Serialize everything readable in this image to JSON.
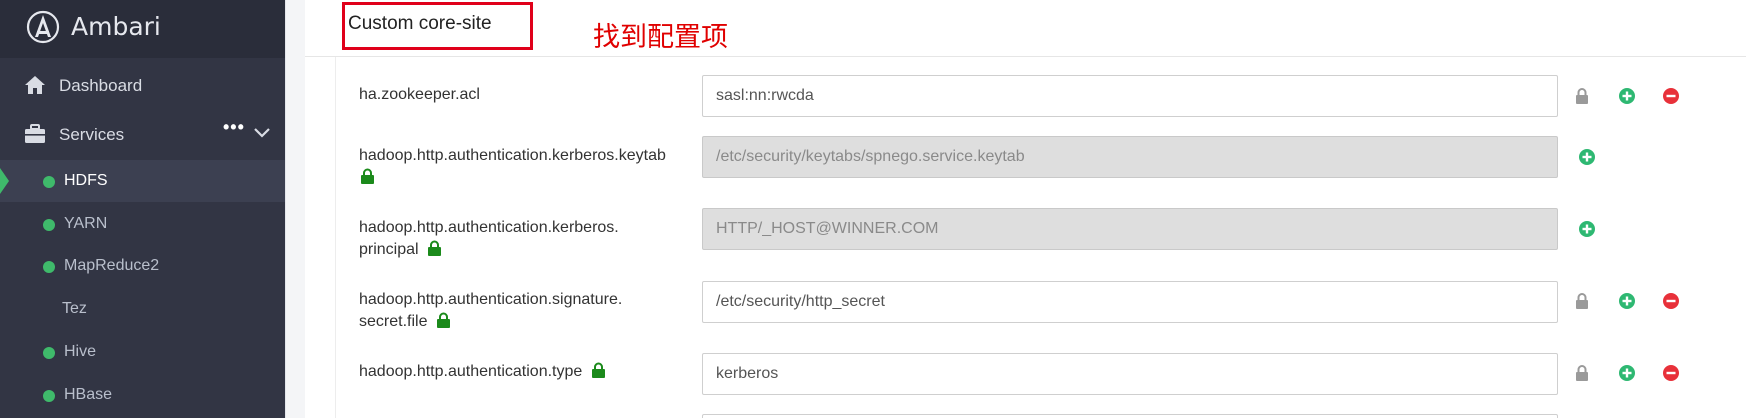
{
  "app": {
    "name": "Ambari"
  },
  "sidebar": {
    "dashboard_label": "Dashboard",
    "services_label": "Services",
    "services_more": "•••",
    "services": [
      {
        "label": "HDFS",
        "status": "green",
        "active": true
      },
      {
        "label": "YARN",
        "status": "green"
      },
      {
        "label": "MapReduce2",
        "status": "green"
      },
      {
        "label": "Tez",
        "status": "none"
      },
      {
        "label": "Hive",
        "status": "green"
      },
      {
        "label": "HBase",
        "status": "green"
      }
    ]
  },
  "section": {
    "title": "Custom core-site",
    "annotation": "找到配置项"
  },
  "properties": [
    {
      "label": "ha.zookeeper.acl",
      "value": "sasl:nn:rwcda",
      "disabled": false,
      "secured": false
    },
    {
      "label": "hadoop.http.authentication.kerberos.keytab",
      "value": "/etc/security/keytabs/spnego.service.keytab",
      "disabled": true,
      "secured": true
    },
    {
      "label_line1": "hadoop.http.authentication.kerberos.",
      "label_line2": "principal",
      "value": "HTTP/_HOST@WINNER.COM",
      "disabled": true,
      "secured": true
    },
    {
      "label_line1": "hadoop.http.authentication.signature.",
      "label_line2": "secret.file",
      "value": "/etc/security/http_secret",
      "disabled": false,
      "secured": true
    },
    {
      "label": "hadoop.http.authentication.type",
      "value": "kerberos",
      "disabled": false,
      "secured": true
    }
  ],
  "colors": {
    "sidebar_bg": "#323544",
    "status_green": "#3fba6b",
    "add_green": "#2eb872",
    "remove_red": "#e8313a",
    "highlight_red": "#e0001a",
    "secure_lock_green": "#1b8a1b"
  }
}
